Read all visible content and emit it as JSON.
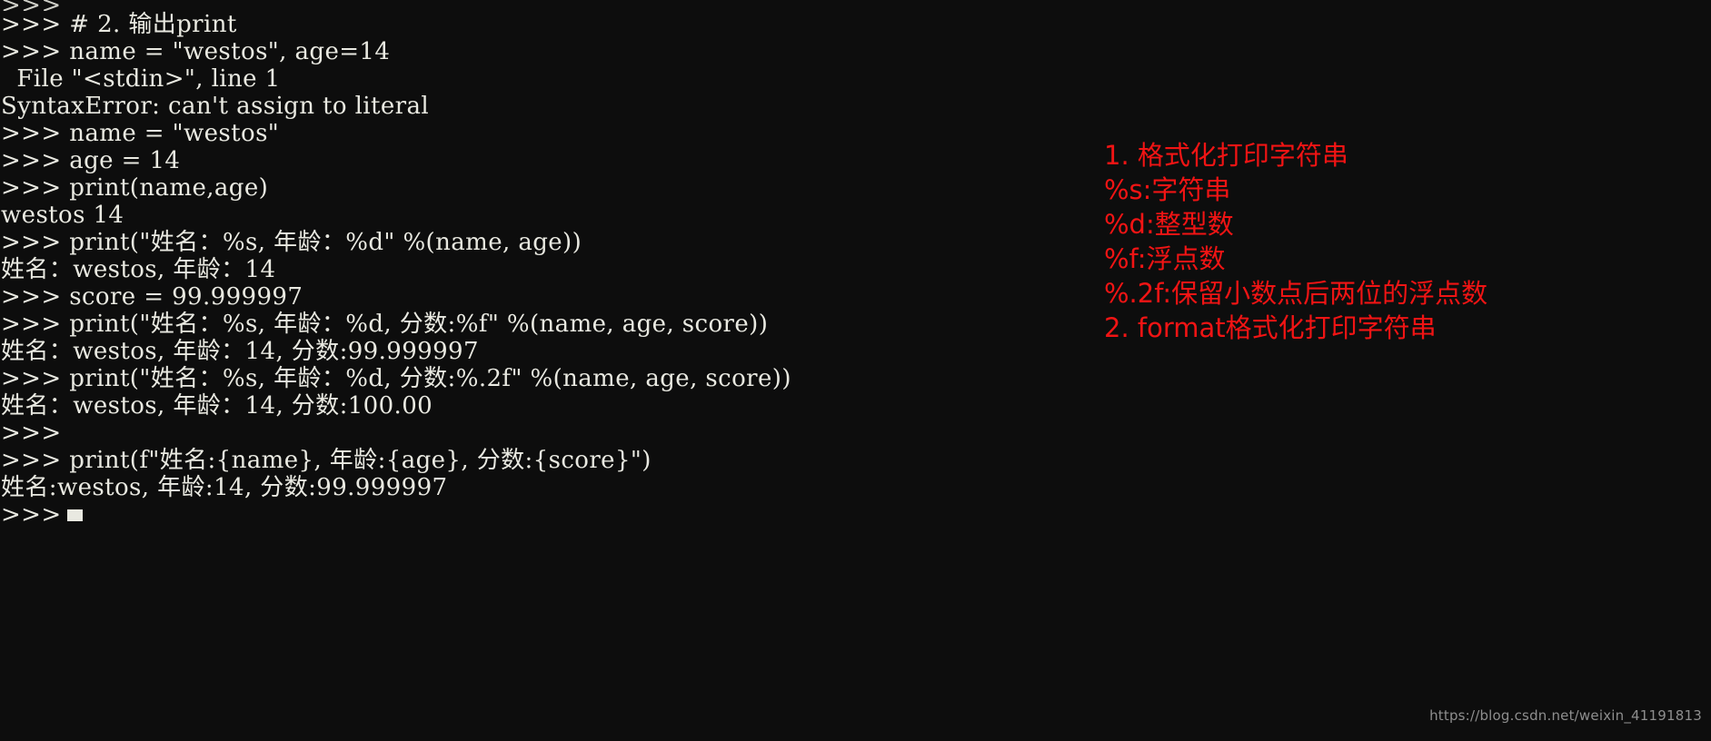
{
  "window": {
    "title": "Python interactive shell",
    "background_color": "#0d0d0d",
    "text_color": "#e9e9e1",
    "accent_color": "#f11414"
  },
  "terminal": {
    "prompt": ">>>",
    "cursor": "block-cursor",
    "lines": [
      {
        "text": ">>>",
        "kind": "prompt-clipped"
      },
      {
        "text": ">>> # 2. 输出print",
        "kind": "input"
      },
      {
        "text": ">>> name = \"westos\", age=14",
        "kind": "input"
      },
      {
        "text": "  File \"<stdin>\", line 1",
        "kind": "output"
      },
      {
        "text": "SyntaxError: can't assign to literal",
        "kind": "output"
      },
      {
        "text": ">>> name = \"westos\"",
        "kind": "input"
      },
      {
        "text": ">>> age = 14",
        "kind": "input"
      },
      {
        "text": ">>> print(name,age)",
        "kind": "input"
      },
      {
        "text": "westos 14",
        "kind": "output"
      },
      {
        "text": ">>> print(\"姓名：%s, 年龄：%d\" %(name, age))",
        "kind": "input"
      },
      {
        "text": "姓名：westos, 年龄：14",
        "kind": "output"
      },
      {
        "text": ">>> score = 99.999997",
        "kind": "input"
      },
      {
        "text": ">>> print(\"姓名：%s, 年龄：%d, 分数:%f\" %(name, age, score))",
        "kind": "input"
      },
      {
        "text": "姓名：westos, 年龄：14, 分数:99.999997",
        "kind": "output"
      },
      {
        "text": ">>> print(\"姓名：%s, 年龄：%d, 分数:%.2f\" %(name, age, score))",
        "kind": "input"
      },
      {
        "text": "姓名：westos, 年龄：14, 分数:100.00",
        "kind": "output"
      },
      {
        "text": ">>>",
        "kind": "input"
      },
      {
        "text": ">>> print(f\"姓名:{name}, 年龄:{age}, 分数:{score}\")",
        "kind": "input"
      },
      {
        "text": "姓名:westos, 年龄:14, 分数:99.999997",
        "kind": "output"
      }
    ],
    "final_prompt": ">>>"
  },
  "annotations": {
    "color": "#f11414",
    "lines": [
      "1. 格式化打印字符串",
      "%s:字符串",
      "%d:整型数",
      "%f:浮点数",
      "%.2f:保留小数点后两位的浮点数",
      "2. format格式化打印字符串"
    ]
  },
  "watermark": {
    "text": "https://blog.csdn.net/weixin_41191813"
  }
}
